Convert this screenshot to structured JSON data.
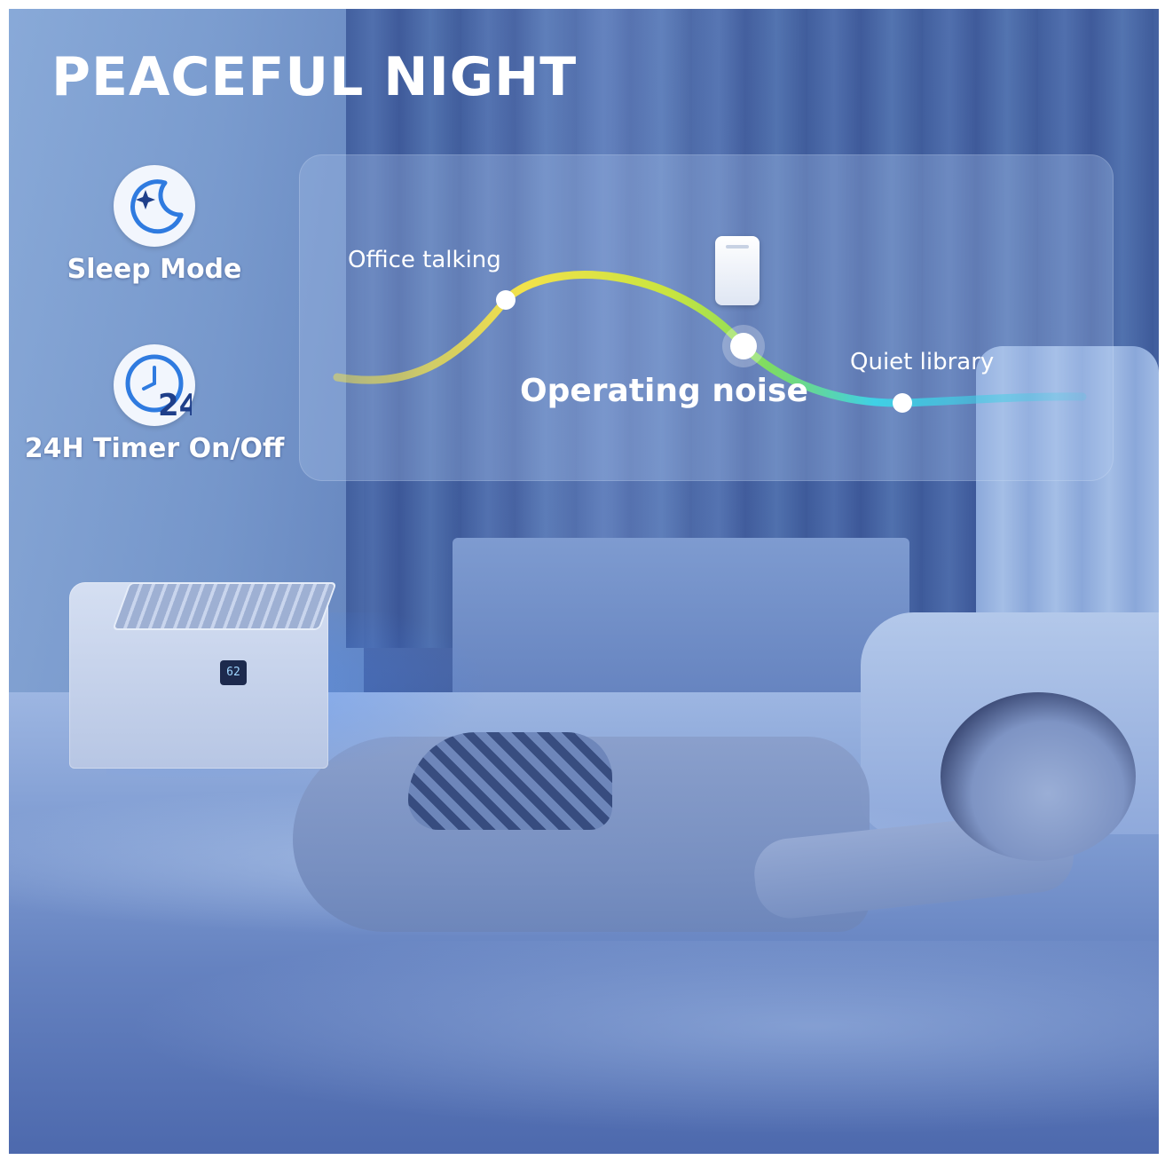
{
  "headline": "PEACEFUL NIGHT",
  "features": [
    {
      "label": "Sleep Mode",
      "icon": "moon-star-icon"
    },
    {
      "label": "24H Timer On/Off",
      "icon": "clock-24-icon",
      "icon_text": "24"
    }
  ],
  "noise_chart": {
    "labels": {
      "office": "Office talking",
      "operating": "Operating noise",
      "quiet": "Quiet library"
    }
  },
  "device": {
    "display_value": "62"
  },
  "colors": {
    "curve_start": "#f2e24a",
    "curve_mid": "#8ee05a",
    "curve_end": "#3fd0e6",
    "icon_blue": "#2f7be0"
  }
}
